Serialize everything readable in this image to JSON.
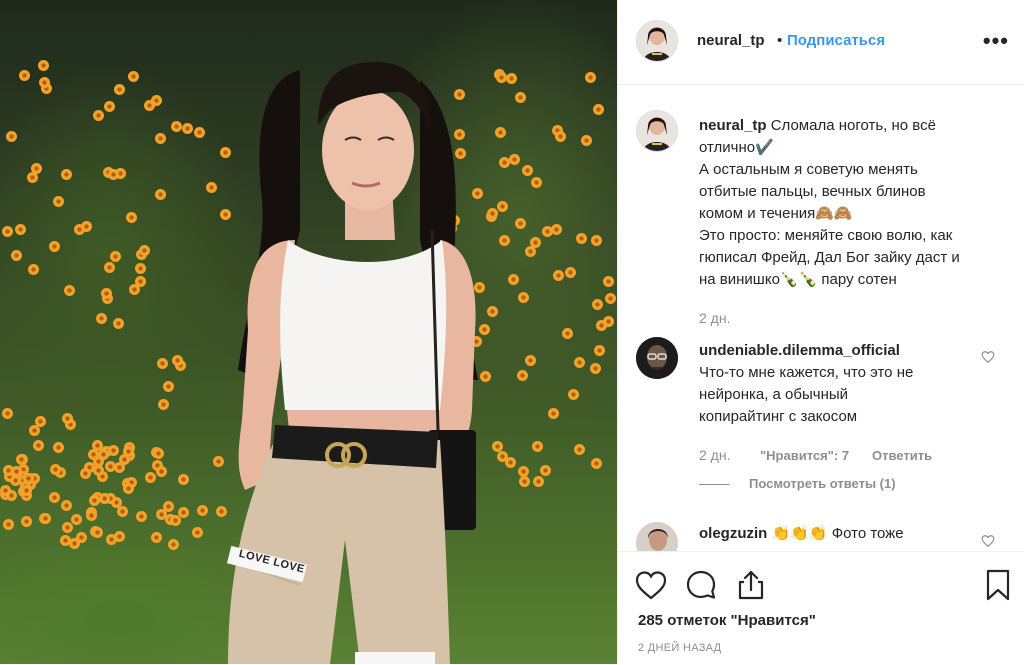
{
  "post": {
    "author": "neural_tp",
    "follow_label": "Подписаться",
    "separator": "•",
    "more_label": "•••",
    "caption_user": "neural_tp",
    "caption_lines": [
      "Сломала ноготь, но всё",
      "отлично✔️",
      "А остальным я советую менять",
      "отбитые пальцы, вечных блинов",
      "комом и течения🙈🙈",
      "Это просто: меняйте свою волю, как",
      "гюписал Фрейд, Дал Бог зайку даст и",
      "на винишко🍾🍾 пару сотен"
    ],
    "caption_time": "2 дн.",
    "likes": "285 отметок \"Нравится\"",
    "posted_ago": "2 ДНЕЙ НАЗАД"
  },
  "comments": [
    {
      "user": "undeniable.dilemma_official",
      "lines": [
        "Что-то мне кажется, что это не",
        "нейронка, а обычный",
        "копирайтинг с закосом"
      ],
      "time": "2 дн.",
      "likes": "\"Нравится\": 7",
      "reply_label": "Ответить",
      "view_replies": "Посмотреть ответы (1)"
    },
    {
      "user": "olegzuzin",
      "text": "👏👏👏 Фото тоже"
    }
  ],
  "photo": {
    "belt_text": "LOVE LOVE"
  },
  "icons": {
    "like": "heart-icon",
    "comment": "comment-icon",
    "share": "share-icon",
    "save": "bookmark-icon"
  },
  "colors": {
    "accent": "#3897f0",
    "muted": "#8e8e8e",
    "border": "#efefef"
  }
}
